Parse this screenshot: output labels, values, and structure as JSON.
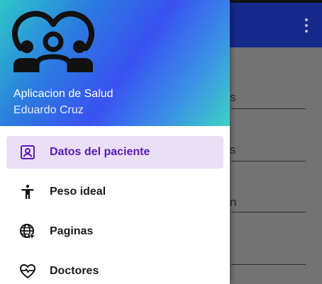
{
  "drawer": {
    "app_title": "Aplicacion de Salud",
    "user_name": "Eduardo Cruz",
    "items": [
      {
        "label": "Datos del paciente",
        "icon": "account-box-icon",
        "active": true
      },
      {
        "label": "Peso ideal",
        "icon": "accessibility-icon",
        "active": false
      },
      {
        "label": "Paginas",
        "icon": "globe-cursor-icon",
        "active": false
      },
      {
        "label": "Doctores",
        "icon": "heart-pulse-icon",
        "active": false
      }
    ]
  },
  "background": {
    "peeks": [
      "s",
      "s",
      "n"
    ]
  },
  "colors": {
    "appbar": "#16288a",
    "active_bg": "#ebdff8",
    "active_text": "#5a1ab5"
  }
}
